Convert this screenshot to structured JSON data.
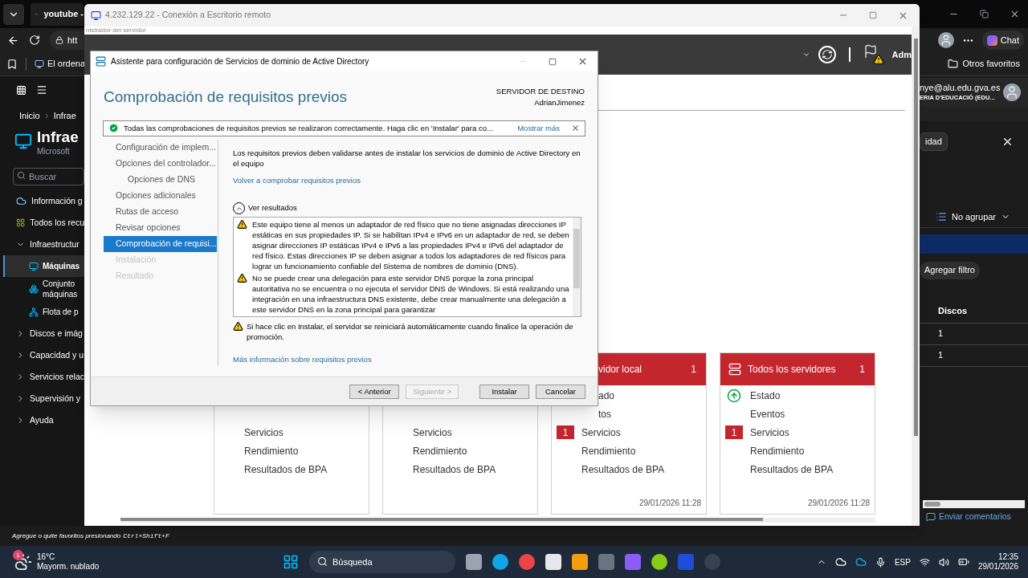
{
  "browser": {
    "tabs": [
      {
        "title": "youtube -",
        "selected": true
      }
    ],
    "address": "htt",
    "chat_button": "Chat",
    "favorites": [
      {
        "label": "El ordena"
      }
    ],
    "other_favorites": "Otros favoritos",
    "status_text": "Agregue o quite favoritos presionando",
    "status_shortcut": "Ctrl+Shift+F"
  },
  "portal": {
    "breadcrumb": [
      "Inicio",
      "Infrae"
    ],
    "title": "Infrae",
    "subtitle": "Microsoft",
    "search": {
      "placeholder": "Buscar"
    },
    "nav": [
      {
        "label": "Información g",
        "kind": "link",
        "selected": false
      },
      {
        "label": "Todos los recu",
        "kind": "link",
        "selected": false
      },
      {
        "label": "Infraestructur",
        "kind": "group",
        "expanded": true,
        "children": [
          {
            "label": "Máquinas",
            "selected": true
          },
          {
            "label": "Conjunto\nmáquinas",
            "selected": false
          },
          {
            "label": "Flota de p",
            "selected": false
          }
        ]
      },
      {
        "label": "Discos e imág",
        "kind": "group",
        "expanded": false
      },
      {
        "label": "Capacidad y u",
        "kind": "group",
        "expanded": false
      },
      {
        "label": "Servicios relac",
        "kind": "group",
        "expanded": false
      },
      {
        "label": "Supervisión y",
        "kind": "group",
        "expanded": false
      },
      {
        "label": "Ayuda",
        "kind": "group",
        "expanded": false
      }
    ],
    "account": {
      "email": "nye@alu.edu.gva.es",
      "org": "ERIA D'EDUCACIÓ (EDU..."
    },
    "chip": "idad",
    "grouping": "No agrupar",
    "filter_button": "Agregar filtro",
    "table": {
      "columns": [
        "Discos"
      ],
      "rows": [
        [
          "1"
        ],
        [
          "1"
        ]
      ]
    },
    "feedback_link": "Enviar comentarios"
  },
  "remote_desktop": {
    "title": "4.232.129.22 - Conexión a Escritorio remoto",
    "app_caption": "nistrador del servidor",
    "user": "Adm",
    "tiles": [
      {
        "kind": "hidden",
        "rows": [
          {
            "label": "Servicios",
            "kind": "plain"
          },
          {
            "label": "Rendimiento",
            "kind": "plain"
          },
          {
            "label": "Resultados de BPA",
            "kind": "plain"
          }
        ]
      },
      {
        "kind": "hidden",
        "rows": [
          {
            "label": "Servicios",
            "kind": "plain"
          },
          {
            "label": "Rendimiento",
            "kind": "plain"
          },
          {
            "label": "Resultados de BPA",
            "kind": "plain"
          }
        ]
      },
      {
        "kind": "cut",
        "title": "vidor local",
        "count": "1",
        "rows": [
          {
            "label": "ado",
            "kind": "cut"
          },
          {
            "label": "tos",
            "kind": "cut"
          },
          {
            "label": "Servicios",
            "kind": "plain",
            "badge": "1"
          },
          {
            "label": "Rendimiento",
            "kind": "plain"
          },
          {
            "label": "Resultados de BPA",
            "kind": "plain"
          }
        ],
        "date": "29/01/2026 11:28"
      },
      {
        "kind": "full",
        "title": "Todos los servidores",
        "count": "1",
        "rows": [
          {
            "label": "Estado",
            "kind": "status"
          },
          {
            "label": "Eventos",
            "kind": "plain"
          },
          {
            "label": "Servicios",
            "kind": "plain",
            "badge": "1"
          },
          {
            "label": "Rendimiento",
            "kind": "plain"
          },
          {
            "label": "Resultados de BPA",
            "kind": "plain"
          }
        ],
        "date": "29/01/2026 11:28"
      }
    ]
  },
  "dialog": {
    "title": "Asistente para configuración de Servicios de dominio de Active Directory",
    "heading": "Comprobación de requisitos previos",
    "target_label": "SERVIDOR DE DESTINO",
    "target_server": "AdrianJimenez",
    "banner": {
      "text": "Todas las comprobaciones de requisitos previos se realizaron correctamente. Haga clic en 'Instalar' para co...",
      "link": "Mostrar más"
    },
    "steps": [
      {
        "label": "Configuración de implem...",
        "selected": false,
        "disabled": false
      },
      {
        "label": "Opciones del controlador...",
        "selected": false,
        "disabled": false,
        "children": [
          {
            "label": "Opciones de DNS",
            "selected": false,
            "disabled": false
          }
        ]
      },
      {
        "label": "Opciones adicionales",
        "selected": false,
        "disabled": false
      },
      {
        "label": "Rutas de acceso",
        "selected": false,
        "disabled": false
      },
      {
        "label": "Revisar opciones",
        "selected": false,
        "disabled": false
      },
      {
        "label": "Comprobación de requisi...",
        "selected": true,
        "disabled": false
      },
      {
        "label": "Instalación",
        "selected": false,
        "disabled": true
      },
      {
        "label": "Resultado",
        "selected": false,
        "disabled": true
      }
    ],
    "description": "Los requisitos previos deben validarse antes de instalar los servicios de dominio de Active Directory en el equipo",
    "recheck_link": "Volver a comprobar requisitos previos",
    "results": {
      "label": "Ver resultados",
      "expanded": true,
      "items": [
        {
          "kind": "warning",
          "text": "Este equipo tiene al menos un adaptador de red físico que no tiene asignadas direcciones IP estáticas en sus propiedades IP. Si se habilitan IPv4 e IPv6 en un adaptador de red, se deben asignar direcciones IP estáticas IPv4 e IPv6 a las propiedades IPv4 e IPv6 del adaptador de red físico. Estas direcciones IP se deben asignar a todos los adaptadores de red físicos para lograr un funcionamiento confiable del Sistema de nombres de dominio (DNS)."
        },
        {
          "kind": "warning",
          "text": "No se puede crear una delegación para este servidor DNS porque la zona principal autoritativa no se encuentra o no ejecuta el servidor DNS de Windows. Si está realizando una integración en una infraestructura DNS existente, debe crear manualmente una delegación a este servidor DNS en la zona principal para garantizar"
        }
      ]
    },
    "notice": "Si hace clic en Instalar, el servidor se reiniciará automáticamente cuando finalice la operación de promoción.",
    "more_link": "Más información sobre requisitos previos",
    "buttons": [
      {
        "label": "< Anterior",
        "disabled": false
      },
      {
        "label": "Siguiente >",
        "disabled": true
      },
      {
        "label": "Instalar",
        "disabled": false
      },
      {
        "label": "Cancelar",
        "disabled": false
      }
    ]
  },
  "taskbar": {
    "weather": {
      "temperature": "16°C",
      "condition": "Mayorm. nublado",
      "badge": "1"
    },
    "search": {
      "placeholder": "Búsqueda"
    },
    "language": "ESP",
    "time": "12:35",
    "date": "29/01/2026"
  }
}
